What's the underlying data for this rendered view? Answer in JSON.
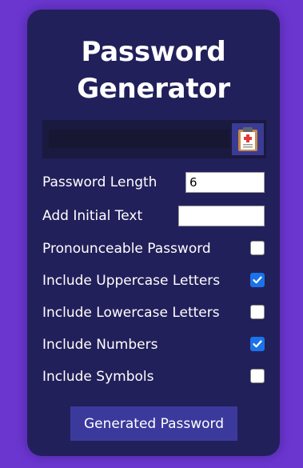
{
  "app": {
    "title_line1": "Password",
    "title_line2": "Generator"
  },
  "output": {
    "value": "",
    "copy_icon": "clipboard-icon"
  },
  "settings": {
    "length": {
      "label": "Password Length",
      "value": "6"
    },
    "initial_text": {
      "label": "Add Initial Text",
      "value": ""
    },
    "pronounceable": {
      "label": "Pronounceable Password",
      "checked": false
    },
    "uppercase": {
      "label": "Include Uppercase Letters",
      "checked": true
    },
    "lowercase": {
      "label": "Include Lowercase Letters",
      "checked": false
    },
    "numbers": {
      "label": "Include Numbers",
      "checked": true
    },
    "symbols": {
      "label": "Include Symbols",
      "checked": false
    }
  },
  "generate_button": {
    "label": "Generated Password"
  },
  "colors": {
    "page_background": "#6b36cf",
    "card_background": "#22205a",
    "button_background": "#3b3a9c",
    "checkbox_checked": "#1a73e8"
  }
}
